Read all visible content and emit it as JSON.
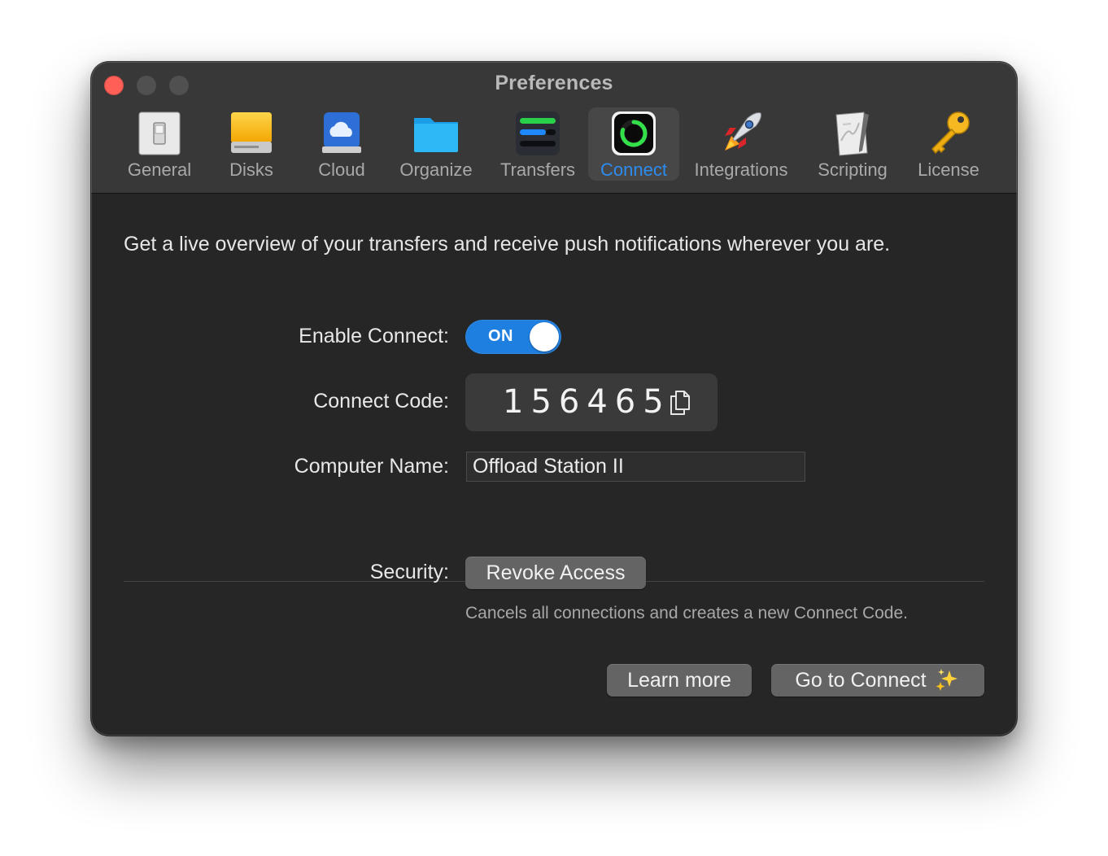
{
  "window": {
    "title": "Preferences"
  },
  "toolbar": {
    "items": [
      {
        "label": "General",
        "icon": "light-switch-icon"
      },
      {
        "label": "Disks",
        "icon": "drive-icon"
      },
      {
        "label": "Cloud",
        "icon": "cloud-drive-icon"
      },
      {
        "label": "Organize",
        "icon": "folder-icon"
      },
      {
        "label": "Transfers",
        "icon": "transfers-bars-icon"
      },
      {
        "label": "Connect",
        "icon": "connect-ring-icon",
        "selected": true
      },
      {
        "label": "Integrations",
        "icon": "rocket-icon"
      },
      {
        "label": "Scripting",
        "icon": "script-paper-icon"
      },
      {
        "label": "License",
        "icon": "key-icon"
      }
    ]
  },
  "content": {
    "intro": "Get a live overview of your transfers and receive push notifications wherever you are.",
    "enable_label": "Enable Connect:",
    "toggle_text": "ON",
    "code_label": "Connect Code:",
    "code_value": "156465",
    "name_label": "Computer Name:",
    "name_value": "Offload Station II",
    "security_label": "Security:",
    "revoke_button": "Revoke Access",
    "revoke_hint": "Cancels all connections and creates a new Connect Code.",
    "learn_more_button": "Learn more",
    "go_connect_button": "Go to Connect"
  },
  "colors": {
    "accent": "#1f7fe0",
    "selected_label": "#2d8cf0",
    "close_button": "#ff5f57"
  }
}
